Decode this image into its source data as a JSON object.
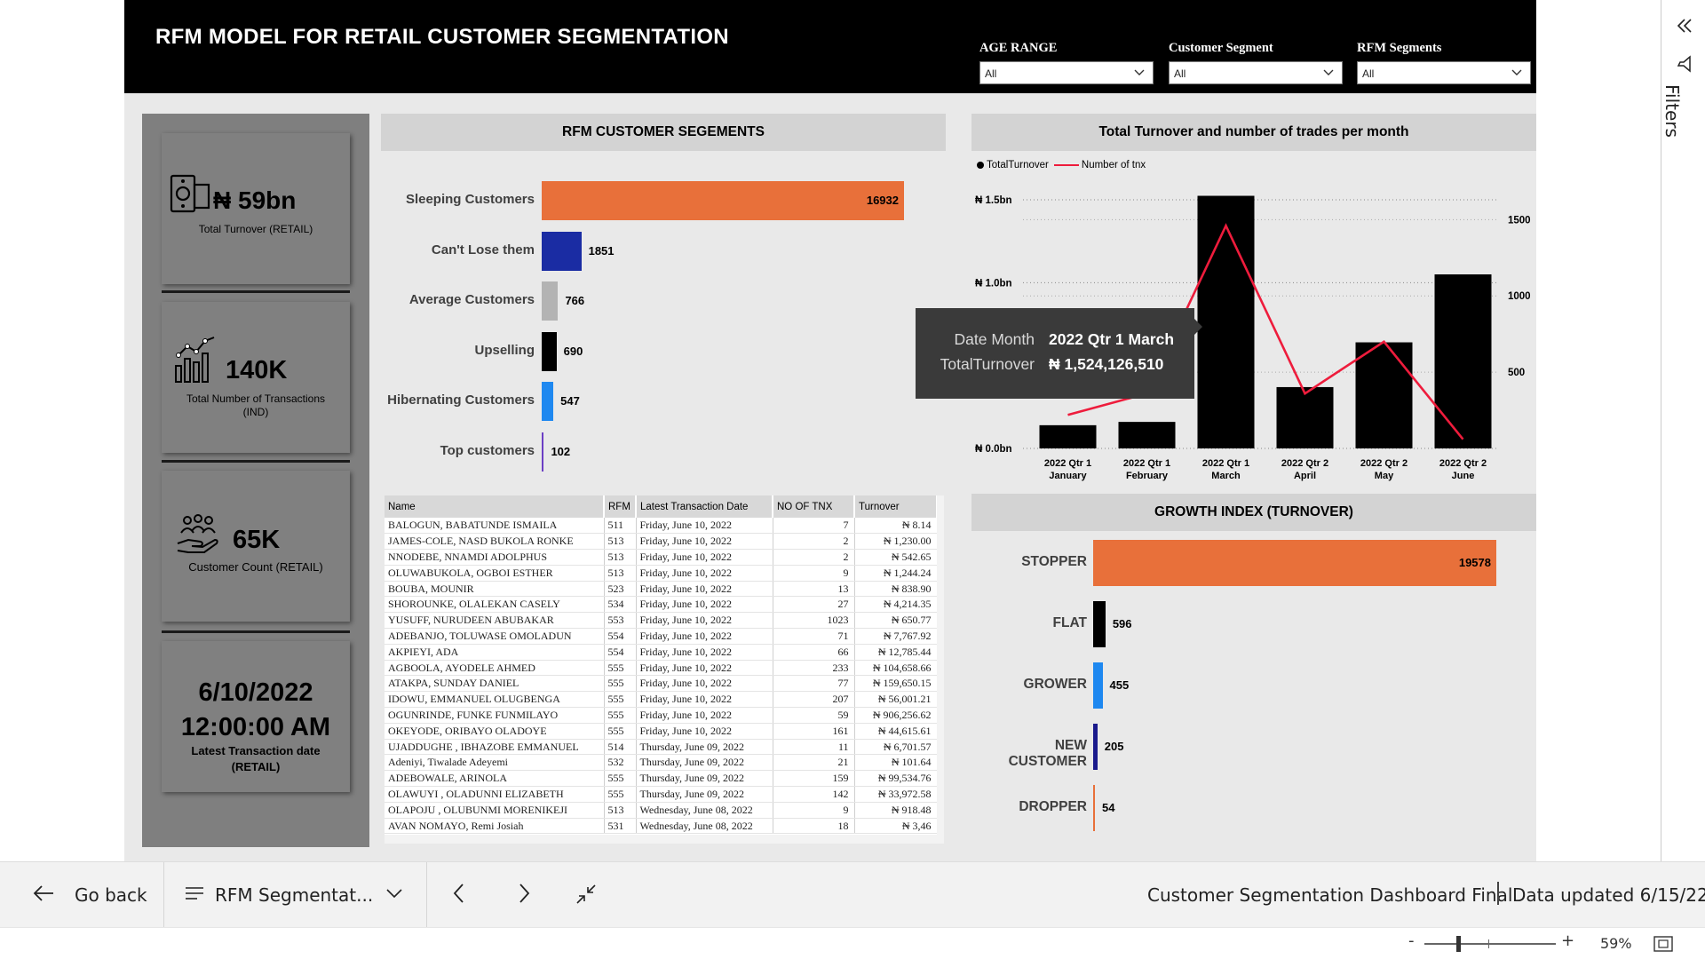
{
  "header": {
    "title": "RFM MODEL FOR RETAIL CUSTOMER SEGMENTATION",
    "slicers": [
      {
        "label": "AGE RANGE",
        "value": "All"
      },
      {
        "label": "Customer Segment",
        "value": "All"
      },
      {
        "label": "RFM Segments",
        "value": "All"
      }
    ]
  },
  "kpis": {
    "turnover": {
      "value": "₦ 59bn",
      "label": "Total Turnover (RETAIL)",
      "icon": "money-icon"
    },
    "transactions": {
      "value": "140K",
      "label_line1": "Total Number of Transactions",
      "label_line2": "(IND)",
      "icon": "chart-icon"
    },
    "customers": {
      "value": "65K",
      "label": "Customer Count (RETAIL)",
      "icon": "customers-hand-icon"
    },
    "latest": {
      "date": "6/10/2022",
      "time": "12:00:00 AM",
      "label_line1": "Latest Transaction date",
      "label_line2": "(RETAIL)"
    }
  },
  "rfm_panel": {
    "title": "RFM CUSTOMER SEGEMENTS"
  },
  "turnover_panel": {
    "title": "Total Turnover and number of trades per month",
    "legend_turnover": "TotalTurnover",
    "legend_tnx": "Number of tnx"
  },
  "growth_panel": {
    "title": "GROWTH INDEX (TURNOVER)"
  },
  "tooltip": {
    "key1": "Date Month",
    "val1": "2022 Qtr 1 March",
    "key2": "TotalTurnover",
    "val2": "₦ 1,524,126,510"
  },
  "colors": {
    "orange": "#e8703a",
    "navy": "#1a2ca3",
    "gray": "#b3b3b3",
    "black": "#000000",
    "blue": "#1e88f0",
    "purple": "#6b3fc4",
    "darknavy": "#1a1a8c",
    "line": "#ee1c3c"
  },
  "chart_data": [
    {
      "type": "bar",
      "orientation": "horizontal",
      "title": "RFM CUSTOMER SEGEMENTS",
      "categories": [
        "Sleeping Customers",
        "Can't Lose them",
        "Average Customers",
        "Upselling",
        "Hibernating Customers",
        "Top customers"
      ],
      "values": [
        16932,
        1851,
        766,
        690,
        547,
        102
      ],
      "colors": [
        "#e8703a",
        "#1a2ca3",
        "#b3b3b3",
        "#000000",
        "#1e88f0",
        "#6b3fc4"
      ]
    },
    {
      "type": "bar",
      "title": "Total Turnover and number of trades per month",
      "categories": [
        "2022 Qtr 1 January",
        "2022 Qtr 1 February",
        "2022 Qtr 1 March",
        "2022 Qtr 2 April",
        "2022 Qtr 2 May",
        "2022 Qtr 2 June"
      ],
      "category_lines": [
        [
          "2022 Qtr 1",
          "January"
        ],
        [
          "2022 Qtr 1",
          "February"
        ],
        [
          "2022 Qtr 1",
          "March"
        ],
        [
          "2022 Qtr 2",
          "April"
        ],
        [
          "2022 Qtr 2",
          "May"
        ],
        [
          "2022 Qtr 2",
          "June"
        ]
      ],
      "series": [
        {
          "name": "TotalTurnover",
          "type": "bar",
          "axis": "left",
          "values": [
            0.14,
            0.16,
            1.524,
            0.37,
            0.64,
            1.05
          ]
        },
        {
          "name": "Number of tnx",
          "type": "line",
          "axis": "right",
          "values": [
            220,
            360,
            1460,
            360,
            700,
            60
          ]
        }
      ],
      "y_left_ticks": [
        "₦ 0.0bn",
        "₦ 1.0bn",
        "₦ 1.5bn"
      ],
      "y_left_tick_values": [
        0,
        1.0,
        1.5
      ],
      "y_left_range": [
        0,
        1.5
      ],
      "y_right_ticks": [
        "500",
        "1000",
        "1500"
      ],
      "y_right_tick_values": [
        500,
        1000,
        1500
      ],
      "y_right_range": [
        0,
        1630
      ],
      "grid": true,
      "legend": "top-left"
    },
    {
      "type": "bar",
      "orientation": "horizontal",
      "title": "GROWTH INDEX (TURNOVER)",
      "categories": [
        "STOPPER",
        "FLAT",
        "GROWER",
        "NEW CUSTOMER",
        "DROPPER"
      ],
      "values": [
        19578,
        596,
        455,
        205,
        54
      ],
      "colors": [
        "#e8703a",
        "#000000",
        "#1e88f0",
        "#1a1a8c",
        "#e8703a"
      ]
    }
  ],
  "table": {
    "columns": [
      "Name",
      "RFM",
      "Latest Transaction Date",
      "NO OF TNX",
      "Turnover"
    ],
    "rows": [
      [
        "BALOGUN, BABATUNDE ISMAILA",
        "511",
        "Friday, June 10, 2022",
        "7",
        "₦ 8.14"
      ],
      [
        "JAMES-COLE, NASD BUKOLA RONKE",
        "513",
        "Friday, June 10, 2022",
        "2",
        "₦ 1,230.00"
      ],
      [
        "NNODEBE, NNAMDI ADOLPHUS",
        "513",
        "Friday, June 10, 2022",
        "2",
        "₦ 542.65"
      ],
      [
        "OLUWABUKOLA, OGBOI ESTHER",
        "513",
        "Friday, June 10, 2022",
        "9",
        "₦ 1,244.24"
      ],
      [
        "BOUBA, MOUNIR",
        "523",
        "Friday, June 10, 2022",
        "13",
        "₦ 838.90"
      ],
      [
        "SHOROUNKE, OLALEKAN CASELY",
        "534",
        "Friday, June 10, 2022",
        "27",
        "₦ 4,214.35"
      ],
      [
        "YUSUFF, NURUDEEN ABUBAKAR",
        "553",
        "Friday, June 10, 2022",
        "1023",
        "₦ 650.77"
      ],
      [
        "ADEBANJO, TOLUWASE OMOLADUN",
        "554",
        "Friday, June 10, 2022",
        "71",
        "₦ 7,767.92"
      ],
      [
        "AKPIEYI, ADA",
        "554",
        "Friday, June 10, 2022",
        "66",
        "₦ 12,785.44"
      ],
      [
        "AGBOOLA, AYODELE AHMED",
        "555",
        "Friday, June 10, 2022",
        "233",
        "₦ 104,658.66"
      ],
      [
        "ATAKPA, SUNDAY DANIEL",
        "555",
        "Friday, June 10, 2022",
        "77",
        "₦ 159,650.15"
      ],
      [
        "IDOWU, EMMANUEL OLUGBENGA",
        "555",
        "Friday, June 10, 2022",
        "207",
        "₦ 56,001.21"
      ],
      [
        "OGUNRINDE, FUNKE FUNMILAYO",
        "555",
        "Friday, June 10, 2022",
        "59",
        "₦ 906,256.62"
      ],
      [
        "OKEYODE, ORIBAYO OLADOYE",
        "555",
        "Friday, June 10, 2022",
        "161",
        "₦ 44,615.61"
      ],
      [
        "UJADDUGHE , IBHAZOBE EMMANUEL",
        "514",
        "Thursday, June 09, 2022",
        "11",
        "₦ 6,701.57"
      ],
      [
        "Adeniyi, Tiwalade Adeyemi",
        "532",
        "Thursday, June 09, 2022",
        "21",
        "₦ 101.64"
      ],
      [
        "ADEBOWALE, ARINOLA",
        "555",
        "Thursday, June 09, 2022",
        "159",
        "₦ 99,534.76"
      ],
      [
        "OLAWUYI , OLADUNNI ELIZABETH",
        "555",
        "Thursday, June 09, 2022",
        "142",
        "₦ 33,972.58"
      ],
      [
        "OLAPOJU , OLUBUNMI MORENIKEJI",
        "513",
        "Wednesday, June 08, 2022",
        "9",
        "₦ 918.48"
      ],
      [
        "AVAN NOMAYO, Remi Josiah",
        "531",
        "Wednesday, June 08, 2022",
        "18",
        "₦ 3,46"
      ]
    ]
  },
  "bottom_bar": {
    "back_label": "Go back",
    "page_label": "RFM Segmentat...",
    "report_name": "Customer Segmentation Dashboard Final",
    "data_updated": "Data updated 6/15/22",
    "zoom": "59%"
  },
  "filters_pane": {
    "label": "Filters"
  }
}
